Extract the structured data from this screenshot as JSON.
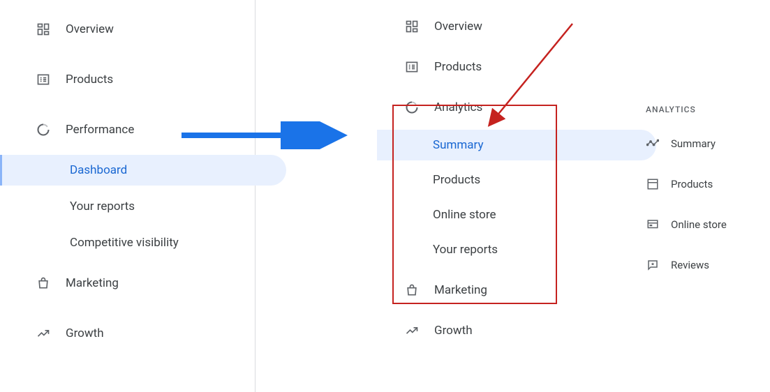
{
  "left_nav": {
    "overview": "Overview",
    "products": "Products",
    "performance": "Performance",
    "dashboard": "Dashboard",
    "your_reports": "Your reports",
    "competitive_visibility": "Competitive visibility",
    "marketing": "Marketing",
    "growth": "Growth"
  },
  "middle_nav": {
    "overview": "Overview",
    "products": "Products",
    "analytics": "Analytics",
    "summary": "Summary",
    "products_sub": "Products",
    "online_store": "Online store",
    "your_reports": "Your reports",
    "marketing": "Marketing",
    "growth": "Growth"
  },
  "right_nav": {
    "header": "ANALYTICS",
    "summary": "Summary",
    "products": "Products",
    "online_store": "Online store",
    "reviews": "Reviews"
  },
  "colors": {
    "blue_arrow": "#1a73e8",
    "red_arrow": "#c5221f",
    "active_bg": "#e8f0fe",
    "active_text": "#1967d2"
  }
}
